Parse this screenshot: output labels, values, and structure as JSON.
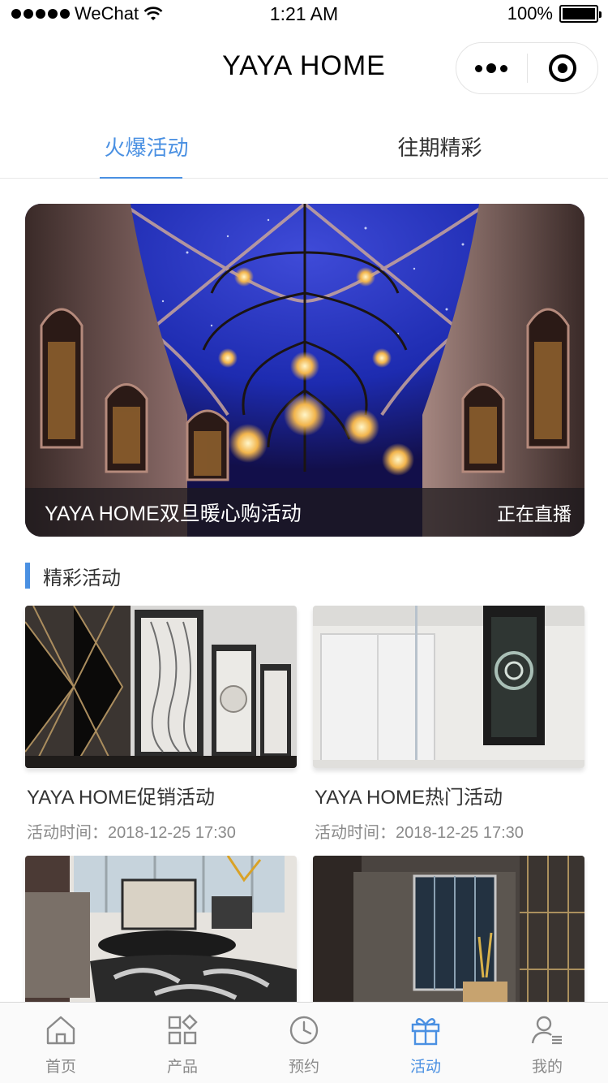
{
  "status_bar": {
    "carrier": "WeChat",
    "time": "1:21 AM",
    "battery": "100%",
    "battery_level": 1.0
  },
  "nav": {
    "title": "YAYA HOME",
    "more_icon": "more-dots-icon",
    "close_icon": "record-close-icon"
  },
  "tabs": [
    {
      "label": "火爆活动",
      "active": true
    },
    {
      "label": "往期精彩",
      "active": false
    }
  ],
  "banner": {
    "title": "YAYA HOME双旦暖心购活动",
    "status": "正在直播"
  },
  "section": {
    "title": "精彩活动"
  },
  "cards": [
    {
      "title": "YAYA HOME促销活动",
      "time": "活动时间：2018-12-25 17:30"
    },
    {
      "title": "YAYA HOME热门活动",
      "time": "活动时间：2018-12-25 17:30"
    },
    {
      "title": "",
      "time": ""
    },
    {
      "title": "",
      "time": ""
    }
  ],
  "tab_bar": [
    {
      "label": "首页",
      "icon": "home-icon",
      "active": false
    },
    {
      "label": "产品",
      "icon": "grid-icon",
      "active": false
    },
    {
      "label": "预约",
      "icon": "clock-icon",
      "active": false
    },
    {
      "label": "活动",
      "icon": "gift-icon",
      "active": true
    },
    {
      "label": "我的",
      "icon": "user-icon",
      "active": false
    }
  ],
  "colors": {
    "accent": "#4a90e2",
    "inactive": "#8a8a8a"
  }
}
